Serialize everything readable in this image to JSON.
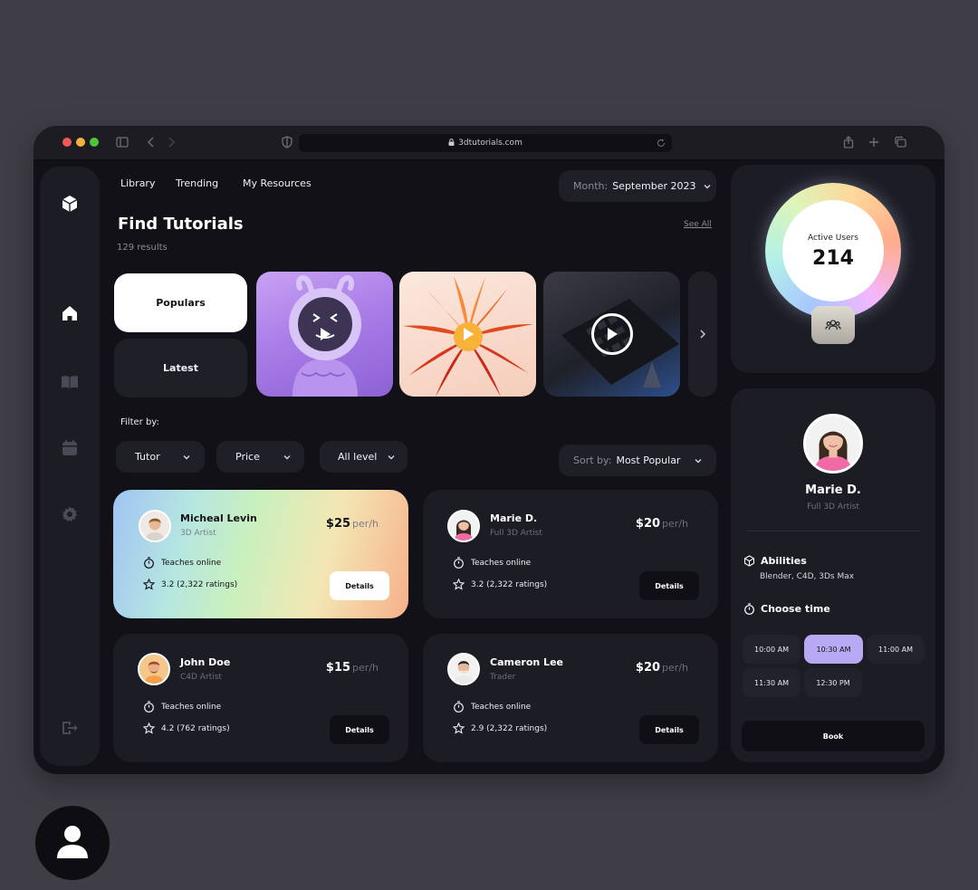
{
  "browser": {
    "url": "3dtutorials.com",
    "traffic_colors": [
      "#ee5b56",
      "#f3b23e",
      "#52c33f"
    ]
  },
  "nav": {
    "links": [
      "Library",
      "Trending",
      "My Resources"
    ],
    "month_label": "Month:",
    "month_value": "September 2023"
  },
  "header": {
    "title": "Find Tutorials",
    "results": "129 results",
    "see_all": "See All"
  },
  "tabs": {
    "populars": "Populars",
    "latest": "Latest"
  },
  "filters": {
    "label": "Filter by:",
    "tutor": "Tutor",
    "price": "Price",
    "level": "All level",
    "sort_label": "Sort by:",
    "sort_value": "Most Popular"
  },
  "tutors": [
    {
      "name": "Micheal Levin",
      "role": "3D Artist",
      "price": "$25",
      "per": "per/h",
      "mode": "Teaches online",
      "rating": "3.2 (2,322 ratings)",
      "details": "Details"
    },
    {
      "name": "Marie D.",
      "role": "Full 3D Artist",
      "price": "$20",
      "per": "per/h",
      "mode": "Teaches online",
      "rating": "3.2 (2,322 ratings)",
      "details": "Details"
    },
    {
      "name": "John Doe",
      "role": "C4D Artist",
      "price": "$15",
      "per": "per/h",
      "mode": "Teaches online",
      "rating": "4.2 (762 ratings)",
      "details": "Details"
    },
    {
      "name": "Cameron Lee",
      "role": "Trader",
      "price": "$20",
      "per": "per/h",
      "mode": "Teaches online",
      "rating": "2.9 (2,322 ratings)",
      "details": "Details"
    }
  ],
  "stats": {
    "label": "Active Users",
    "value": "214"
  },
  "profile": {
    "name": "Marie D.",
    "role": "Full 3D Artist",
    "abilities_title": "Abilities",
    "abilities": "Blender, C4D, 3Ds Max",
    "time_title": "Choose time",
    "slots": [
      "10:00 AM",
      "10:30 AM",
      "11:00 AM",
      "11:30 AM",
      "12:30 PM"
    ],
    "selected_slot": "10:30 AM",
    "book": "Book"
  },
  "colors": {
    "accent": "#b8a9f4",
    "background": "#111117",
    "panel": "#1c1c25"
  }
}
